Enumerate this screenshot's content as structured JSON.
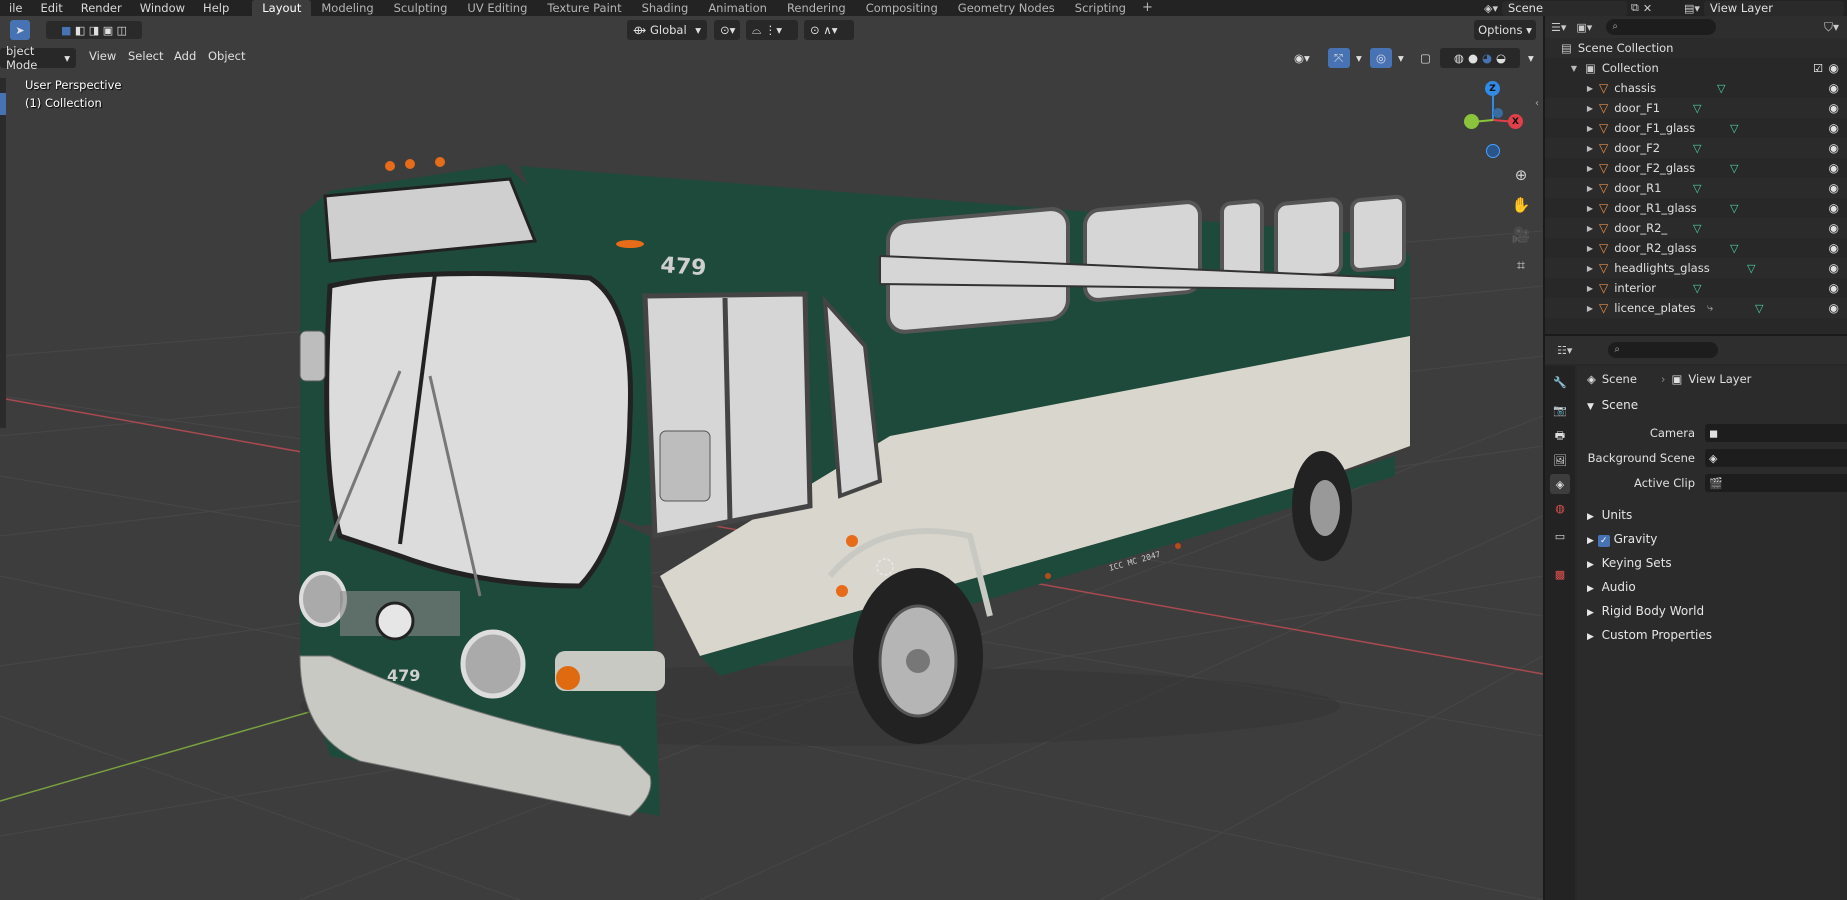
{
  "menu": [
    "ile",
    "Edit",
    "Render",
    "Window",
    "Help"
  ],
  "workspaces": [
    "Layout",
    "Modeling",
    "Sculpting",
    "UV Editing",
    "Texture Paint",
    "Shading",
    "Animation",
    "Rendering",
    "Compositing",
    "Geometry Nodes",
    "Scripting"
  ],
  "active_workspace": "Layout",
  "plus_tab": "+",
  "scene_field": "Scene",
  "view_layer_field": "View Layer",
  "viewport": {
    "mode": "bject Mode",
    "menus": [
      "View",
      "Select",
      "Add",
      "Object"
    ],
    "transform_orientation": "Global",
    "options_label": "Options",
    "perspective": "User Perspective",
    "collection": "(1) Collection",
    "gizmo_axes": [
      "Z",
      "X",
      "Y"
    ],
    "colors": {
      "x": "#e0404a",
      "y": "#8bc43c",
      "z": "#2f8be6",
      "grid": "#4a4a4a"
    }
  },
  "bus": {
    "number": "479",
    "side_text": "ICC MC 2047",
    "plate": "479",
    "colors": {
      "body": "#1e4a3c",
      "cream": "#d9d6cd",
      "glass": "#d6d6d6",
      "tire": "#222222"
    }
  },
  "outliner": {
    "root": "Scene Collection",
    "collection": "Collection",
    "items": [
      "chassis",
      "door_F1",
      "door_F1_glass",
      "door_F2",
      "door_F2_glass",
      "door_R1",
      "door_R1_glass",
      "door_R2_",
      "door_R2_glass",
      "headlights_glass",
      "interior",
      "licence_plates"
    ]
  },
  "properties": {
    "breadcrumb_scene": "Scene",
    "breadcrumb_view_layer": "View Layer",
    "section": "Scene",
    "fields": [
      {
        "label": "Camera"
      },
      {
        "label": "Background Scene"
      },
      {
        "label": "Active Clip"
      }
    ],
    "panels": [
      "Units",
      "Gravity",
      "Keying Sets",
      "Audio",
      "Rigid Body World",
      "Custom Properties"
    ],
    "gravity_checked": true
  }
}
